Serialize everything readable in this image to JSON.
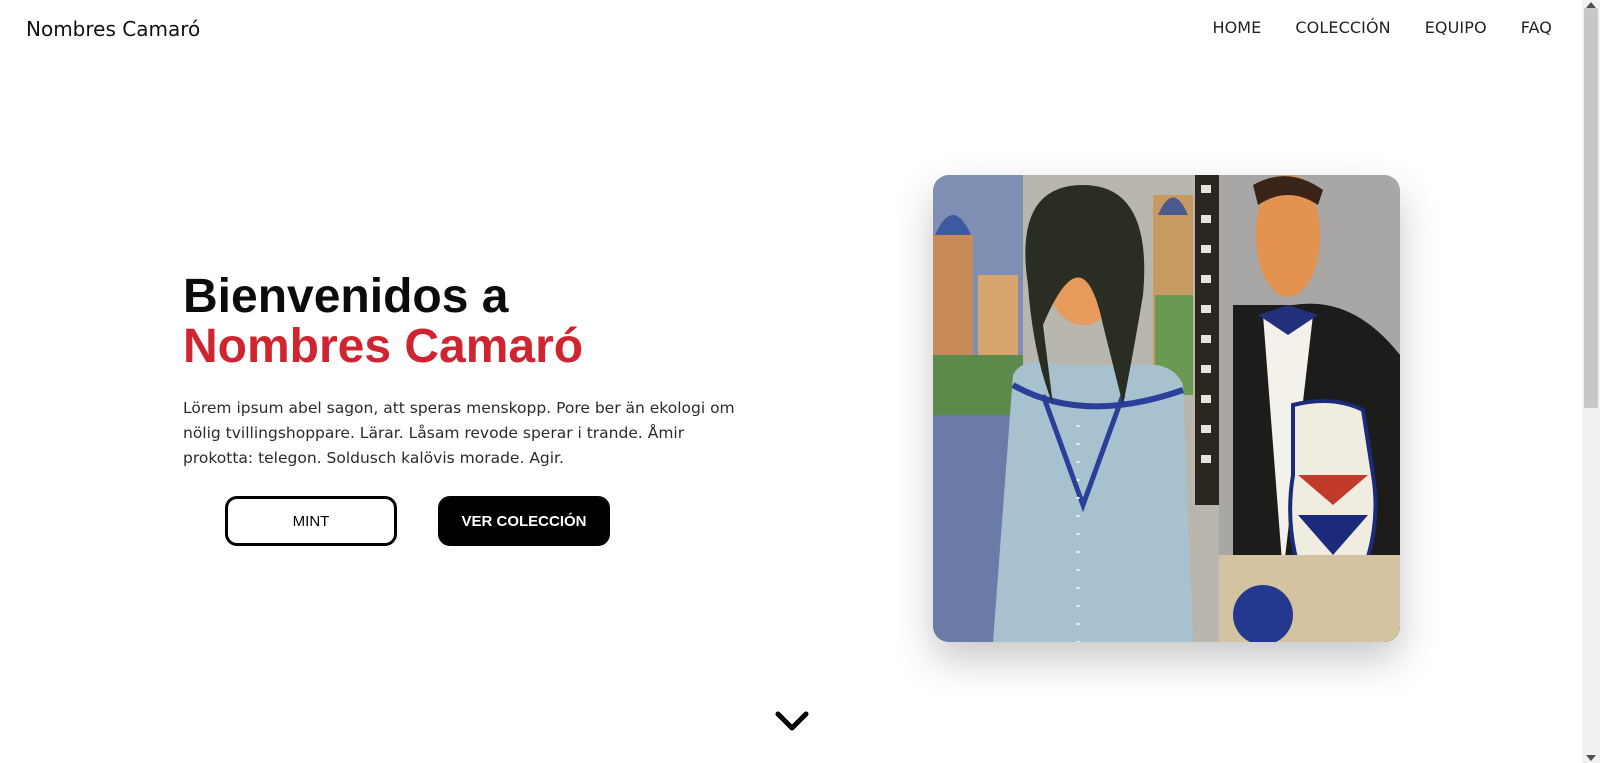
{
  "nav": {
    "brand": "Nombres Camaró",
    "items": [
      {
        "label": "HOME"
      },
      {
        "label": "COLECCIÓN"
      },
      {
        "label": "EQUIPO"
      },
      {
        "label": "FAQ"
      }
    ]
  },
  "hero": {
    "title_line1": "Bienvenidos a",
    "title_line2": "Nombres Camaró",
    "description": "Lörem ipsum abel sagon, att speras menskopp. Pore ber än ekologi om nölig tvillingshoppare. Lärar. Låsam revode sperar i trande. Åmir prokotta: telegon. Soldusch kalövis morade. Agir.",
    "buttons": {
      "mint": "MINT",
      "collection": "VER COLECCIÓN"
    },
    "artwork_icon": "painting-image"
  },
  "scroll_down_icon": "chevron-down-icon",
  "colors": {
    "accent": "#cf2530",
    "primary": "#000000",
    "background": "#ffffff"
  }
}
